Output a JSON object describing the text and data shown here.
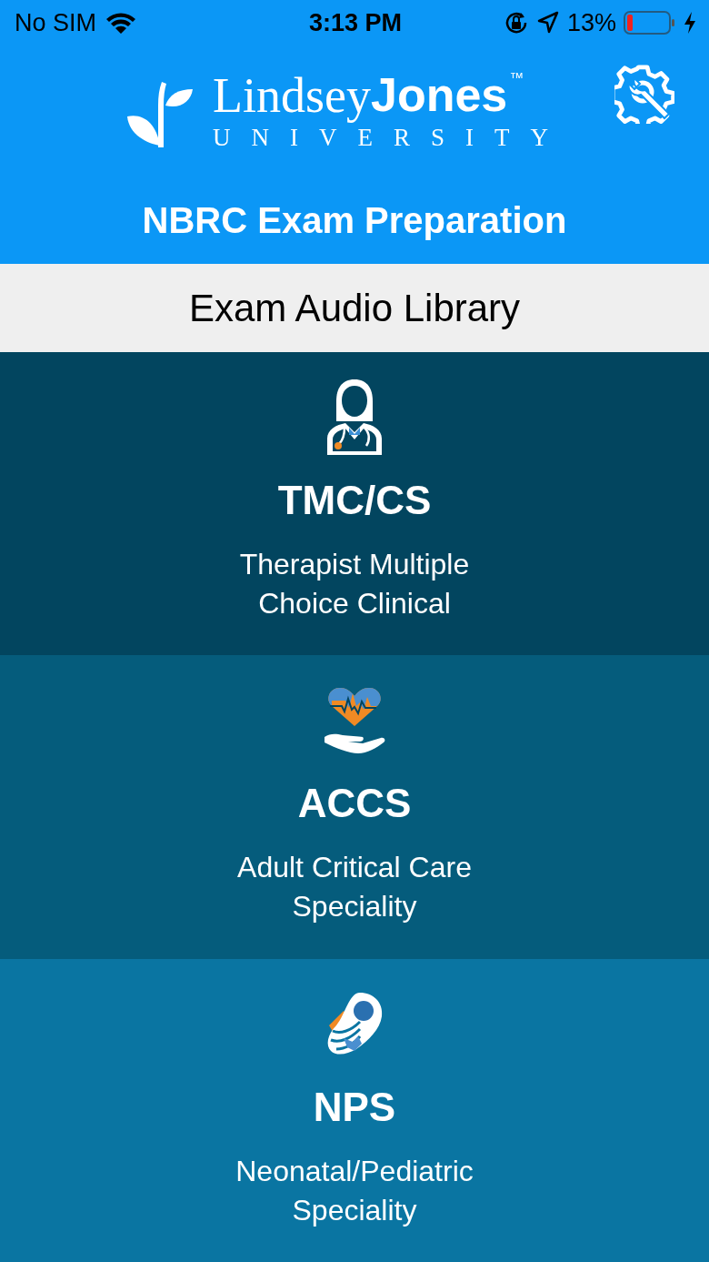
{
  "status_bar": {
    "carrier": "No SIM",
    "time": "3:13 PM",
    "battery": "13%"
  },
  "header": {
    "logo": {
      "first": "Lindsey",
      "second": "Jones",
      "mark": "™",
      "subtitle": "UNIVERSITY"
    },
    "title": "NBRC Exam Preparation"
  },
  "section_title": "Exam Audio Library",
  "exams": [
    {
      "kind": "doctor",
      "code": "TMC/CS",
      "description": "Therapist Multiple Choice Clinical",
      "color": "#02455f"
    },
    {
      "kind": "heart",
      "code": "ACCS",
      "description": "Adult Critical Care Speciality",
      "color": "#055c7c"
    },
    {
      "kind": "baby",
      "code": "NPS",
      "description": "Neonatal/Pediatric Speciality",
      "color": "#0a75a2"
    }
  ]
}
